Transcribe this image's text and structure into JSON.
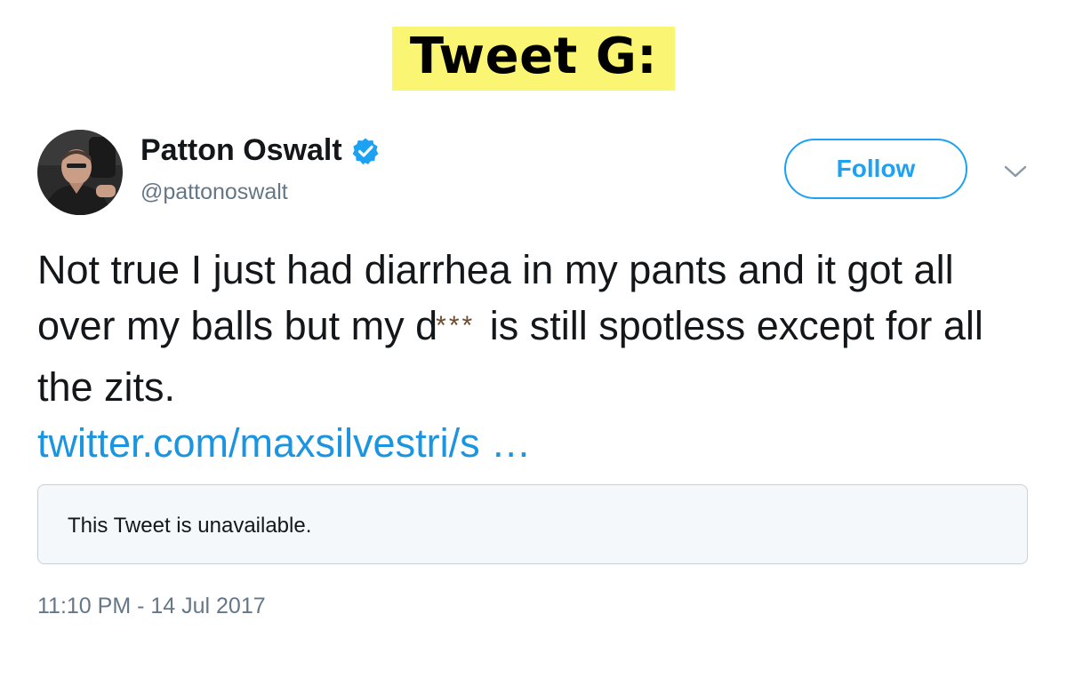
{
  "label": "Tweet G:",
  "tweet": {
    "author": {
      "display_name": "Patton Oswalt",
      "handle": "@pattonoswalt",
      "verified_icon": "verified-badge-icon",
      "avatar": "profile-photo"
    },
    "follow_label": "Follow",
    "menu_icon": "chevron-down-icon",
    "text_part1": "Not true I just had diarrhea in my pants and it got all over my balls but my d",
    "censor": "***",
    "text_part2": " is still spotless except for all the zits.",
    "link": "twitter.com/maxsilvestri/s …",
    "quoted_notice": "This Tweet is unavailable.",
    "timestamp": "11:10 PM - 14 Jul 2017"
  },
  "colors": {
    "label_highlight": "#fbf574",
    "accent_blue": "#1da1f2",
    "link_blue": "#1b95e0",
    "secondary_text": "#657786",
    "censor_brown": "#6d4a2f"
  }
}
